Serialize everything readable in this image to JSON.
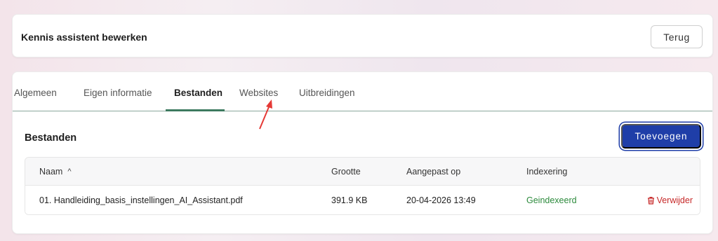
{
  "header": {
    "title": "Kennis assistent bewerken",
    "back_label": "Terug"
  },
  "tabs": [
    {
      "label": "Algemeen",
      "active": false
    },
    {
      "label": "Eigen informatie",
      "active": false
    },
    {
      "label": "Bestanden",
      "active": true
    },
    {
      "label": "Websites",
      "active": false
    },
    {
      "label": "Uitbreidingen",
      "active": false
    }
  ],
  "section": {
    "title": "Bestanden",
    "add_label": "Toevoegen"
  },
  "table": {
    "headers": {
      "name": "Naam",
      "size": "Grootte",
      "modified": "Aangepast op",
      "indexing": "Indexering"
    },
    "sort_icon": "chevron-up-icon",
    "rows": [
      {
        "name": "01. Handleiding_basis_instellingen_AI_Assistant.pdf",
        "size": "391.9 KB",
        "modified": "20-04-2026 13:49",
        "indexing": "Geindexeerd",
        "action": "Verwijder"
      }
    ]
  },
  "colors": {
    "accent": "#1f3ea8",
    "tab_underline": "#3d7a5f",
    "status_ok": "#2c8a3c",
    "danger": "#c62828",
    "annotation_arrow": "#e53935"
  }
}
